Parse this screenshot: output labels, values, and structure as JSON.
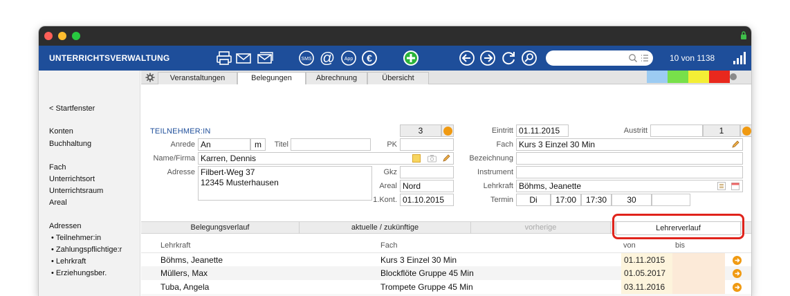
{
  "app": {
    "title": "UNTERRICHTSVERWALTUNG",
    "counter": "10 von 1138",
    "search_placeholder": ""
  },
  "sidebar": {
    "back": "< Startfenster",
    "items": [
      "Konten",
      "Buchhaltung",
      "Fach",
      "Unterrichtsort",
      "Unterrichtsraum",
      "Areal",
      "Adressen"
    ],
    "sub_items": [
      "• Teilnehmer:in",
      "• Zahlungspflichtige:r",
      "• Lehrkraft",
      "• Erziehungsber."
    ]
  },
  "tabs": [
    "Veranstaltungen",
    "Belegungen",
    "Abrechnung",
    "Übersicht"
  ],
  "colors": {
    "accent": "#1e4e9a",
    "orange": "#f09a12",
    "highlight": "#e0231b"
  },
  "color_bars": [
    "#9ccbf2",
    "#78e04a",
    "#f3ee35",
    "#e8281d"
  ],
  "form": {
    "section": "TEILNEHMER:IN",
    "number": "3",
    "anrede_label": "Anrede",
    "anrede": "An",
    "anrede_code": "m",
    "titel_label": "Titel",
    "titel": "",
    "pk_label": "PK",
    "pk": "",
    "name_label": "Name/Firma",
    "name": "Karren, Dennis",
    "adresse_label": "Adresse",
    "adresse_line1": "Filbert-Weg 37",
    "adresse_line2": "12345 Musterhausen",
    "gkz_label": "Gkz",
    "gkz": "",
    "areal_label": "Areal",
    "areal": "Nord",
    "kont_label": "1.Kont.",
    "kont": "01.10.2015",
    "eintritt_label": "Eintritt",
    "eintritt": "01.11.2015",
    "austritt_label": "Austritt",
    "austritt": "",
    "austritt_num": "1",
    "fach_label": "Fach",
    "fach": "Kurs 3 Einzel 30 Min",
    "bezeichnung_label": "Bezeichnung",
    "bezeichnung": "",
    "instrument_label": "Instrument",
    "instrument": "",
    "lehrkraft_label": "Lehrkraft",
    "lehrkraft": "Böhms, Jeanette",
    "termin_label": "Termin",
    "termin_day": "Di",
    "termin_from": "17:00",
    "termin_to": "17:30",
    "termin_min": "30"
  },
  "subtabs": [
    "Belegungsverlauf",
    "aktuelle / zukünftige",
    "vorherige",
    "Lehrerverlauf"
  ],
  "table": {
    "headers": {
      "lehrkraft": "Lehrkraft",
      "fach": "Fach",
      "von": "von",
      "bis": "bis"
    },
    "rows": [
      {
        "lehrkraft": "Böhms, Jeanette",
        "fach": "Kurs 3 Einzel 30 Min",
        "von": "01.11.2015",
        "bis": ""
      },
      {
        "lehrkraft": "Müllers, Max",
        "fach": "Blockflöte Gruppe 45 Min",
        "von": "01.05.2017",
        "bis": ""
      },
      {
        "lehrkraft": "Tuba, Angela",
        "fach": "Trompete Gruppe 45 Min",
        "von": "03.11.2016",
        "bis": ""
      }
    ]
  }
}
